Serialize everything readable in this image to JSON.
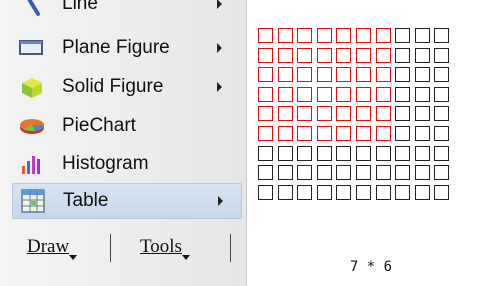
{
  "menu": {
    "items": [
      {
        "label": "Line",
        "icon": "line-icon",
        "has_submenu": true
      },
      {
        "label": "Plane Figure",
        "icon": "plane-figure-icon",
        "has_submenu": true
      },
      {
        "label": "Solid Figure",
        "icon": "solid-figure-icon",
        "has_submenu": true
      },
      {
        "label": "PieChart",
        "icon": "piechart-icon",
        "has_submenu": false
      },
      {
        "label": "Histogram",
        "icon": "histogram-icon",
        "has_submenu": false
      },
      {
        "label": "Table",
        "icon": "table-icon",
        "has_submenu": true,
        "selected": true
      }
    ],
    "tabs": [
      {
        "label": "Draw"
      },
      {
        "label": "Tools"
      }
    ]
  },
  "table_picker": {
    "columns": 10,
    "rows": 9,
    "selected_columns": 7,
    "selected_rows": 6,
    "size_label": "7 * 6",
    "selected_color": "#e01010",
    "cell_color": "#222222"
  }
}
